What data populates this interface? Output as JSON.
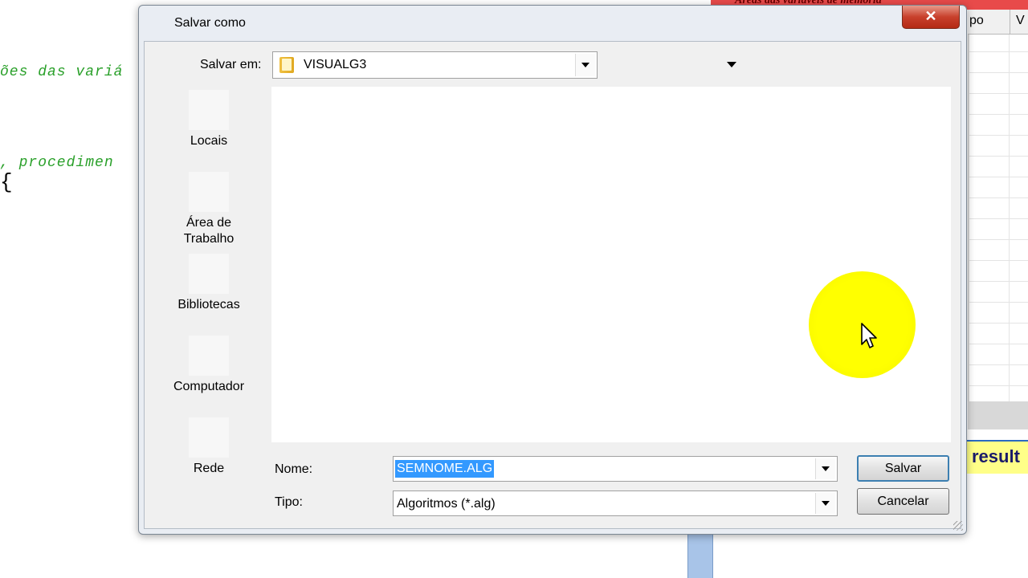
{
  "background": {
    "code_line_1": "ões das variá",
    "code_line_2": ", procedimen",
    "code_brace": "{",
    "top_banner": "Áreas das variáveis de memória",
    "grid_header_col1": "po",
    "grid_header_col2": "V",
    "result_label": "result"
  },
  "dialog": {
    "title": "Salvar como",
    "close_glyph": "✕",
    "save_in_label": "Salvar em:",
    "save_in_value": "VISUALG3",
    "places": [
      {
        "label": "Locais",
        "icon": "recent-places-icon"
      },
      {
        "label": "Área de\nTrabalho",
        "icon": "desktop-icon"
      },
      {
        "label": "Bibliotecas",
        "icon": "libraries-icon"
      },
      {
        "label": "Computador",
        "icon": "computer-icon"
      },
      {
        "label": "Rede",
        "icon": "network-icon"
      }
    ],
    "name_label": "Nome:",
    "name_value": "SEMNOME.ALG",
    "type_label": "Tipo:",
    "type_value": "Algoritmos (*.alg)",
    "save_button": "Salvar",
    "cancel_button": "Cancelar"
  },
  "colors": {
    "selection": "#3399ff",
    "close_button": "#c8402c",
    "cursor_highlight": "#ffff00"
  }
}
